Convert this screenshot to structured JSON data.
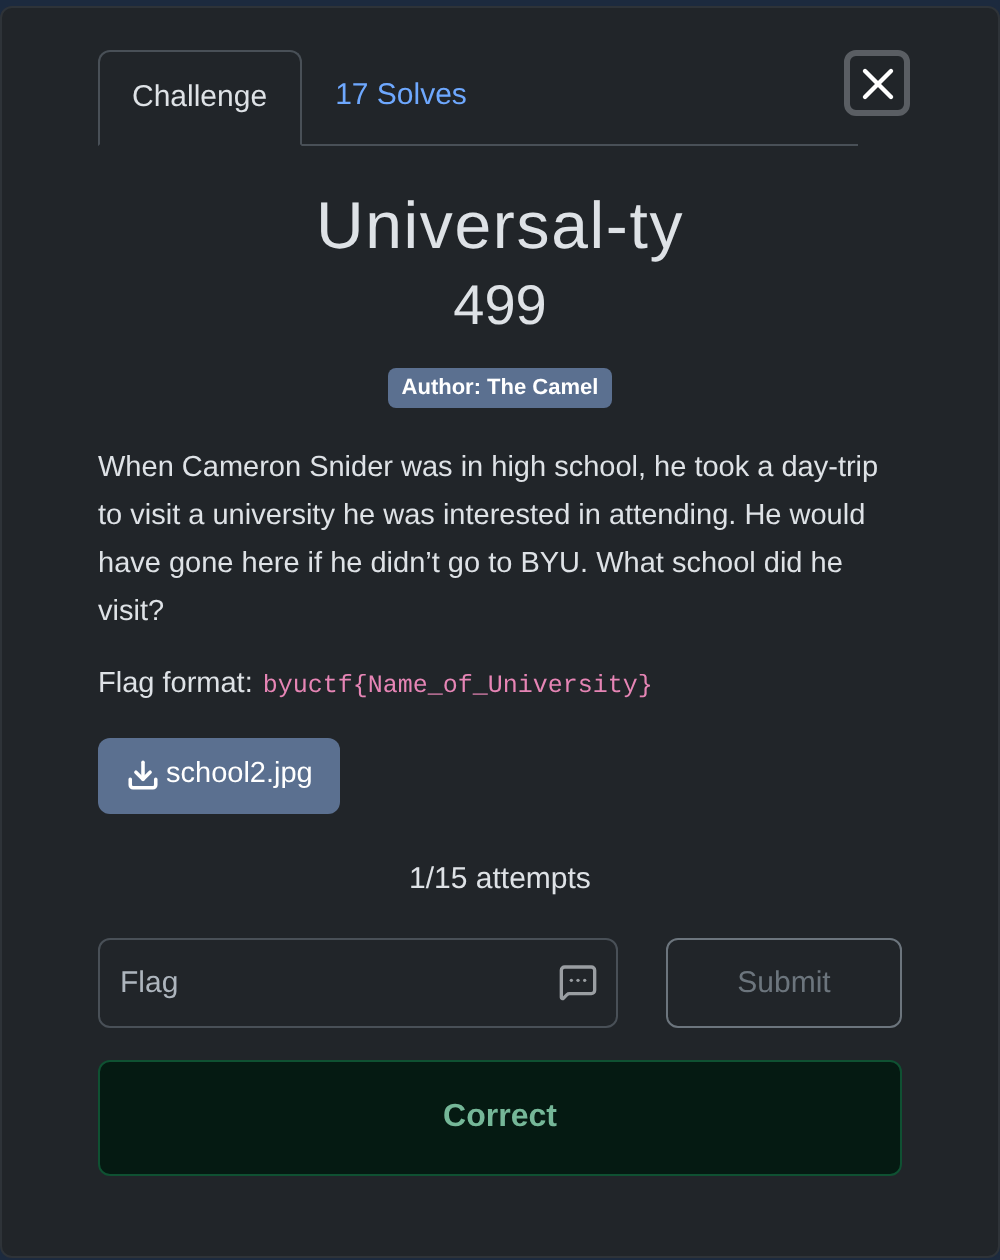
{
  "tabs": [
    {
      "label": "Challenge",
      "selected": true
    },
    {
      "label": "17 Solves",
      "selected": false
    }
  ],
  "challenge": {
    "name": "Universal-ty",
    "points": "499",
    "author": "Author: The Camel",
    "description": "When Cameron Snider was in high school, he took a day-trip to visit a university he was interested in attending. He would have gone here if he didn’t go to BYU. What school did he visit?",
    "flag_format_label": "Flag format:",
    "flag_format": "byuctf{Name_of_University}",
    "file": "school2.jpg",
    "attempts": "1/15 attempts"
  },
  "flag_field": {
    "placeholder": "Flag"
  },
  "submit": {
    "label": "Submit",
    "disabled": true
  },
  "result": {
    "kind": "correct",
    "text": "Correct"
  }
}
